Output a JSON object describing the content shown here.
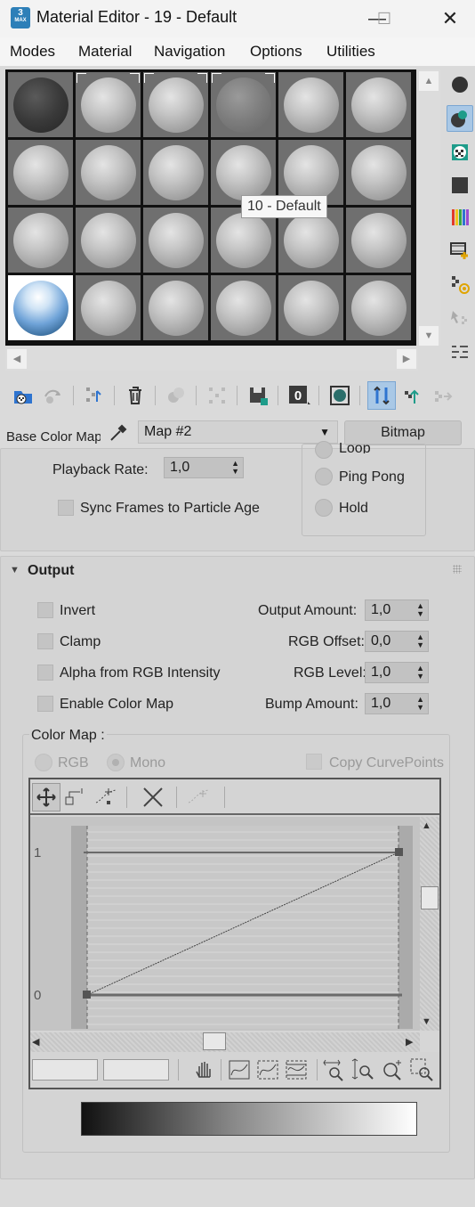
{
  "window": {
    "app_icon_text": "3",
    "app_icon_sub": "MAX",
    "title": "Material Editor - 19 - Default",
    "minimize": "—",
    "maximize": "☐",
    "close": "✕"
  },
  "menu": [
    "Modes",
    "Material",
    "Navigation",
    "Options",
    "Utilities"
  ],
  "tooltip": "10 - Default",
  "base_color": {
    "label": "Base Color Map",
    "map_name": "Map #2",
    "map_type": "Bitmap"
  },
  "time_panel": {
    "playback_rate_label": "Playback Rate:",
    "playback_rate_value": "1,0",
    "sync_frames_label": "Sync Frames to Particle Age",
    "end_conditions": [
      "Loop",
      "Ping Pong",
      "Hold"
    ]
  },
  "output_panel": {
    "title": "Output",
    "checkboxes": [
      "Invert",
      "Clamp",
      "Alpha from RGB Intensity",
      "Enable Color Map"
    ],
    "fields": [
      {
        "label": "Output Amount:",
        "value": "1,0"
      },
      {
        "label": "RGB Offset:",
        "value": "0,0"
      },
      {
        "label": "RGB Level:",
        "value": "1,0"
      },
      {
        "label": "Bump Amount:",
        "value": "1,0"
      }
    ],
    "color_map_label": "Color Map :",
    "rgb_option": "RGB",
    "mono_option": "Mono",
    "copy_curvepoints": "Copy CurvePoints",
    "curve_y_labels": [
      "1",
      "0"
    ]
  },
  "colors": {
    "selection_blue": "#a9c8e6",
    "panel_bg": "#d4d4d4",
    "window_bg": "#dadada"
  }
}
